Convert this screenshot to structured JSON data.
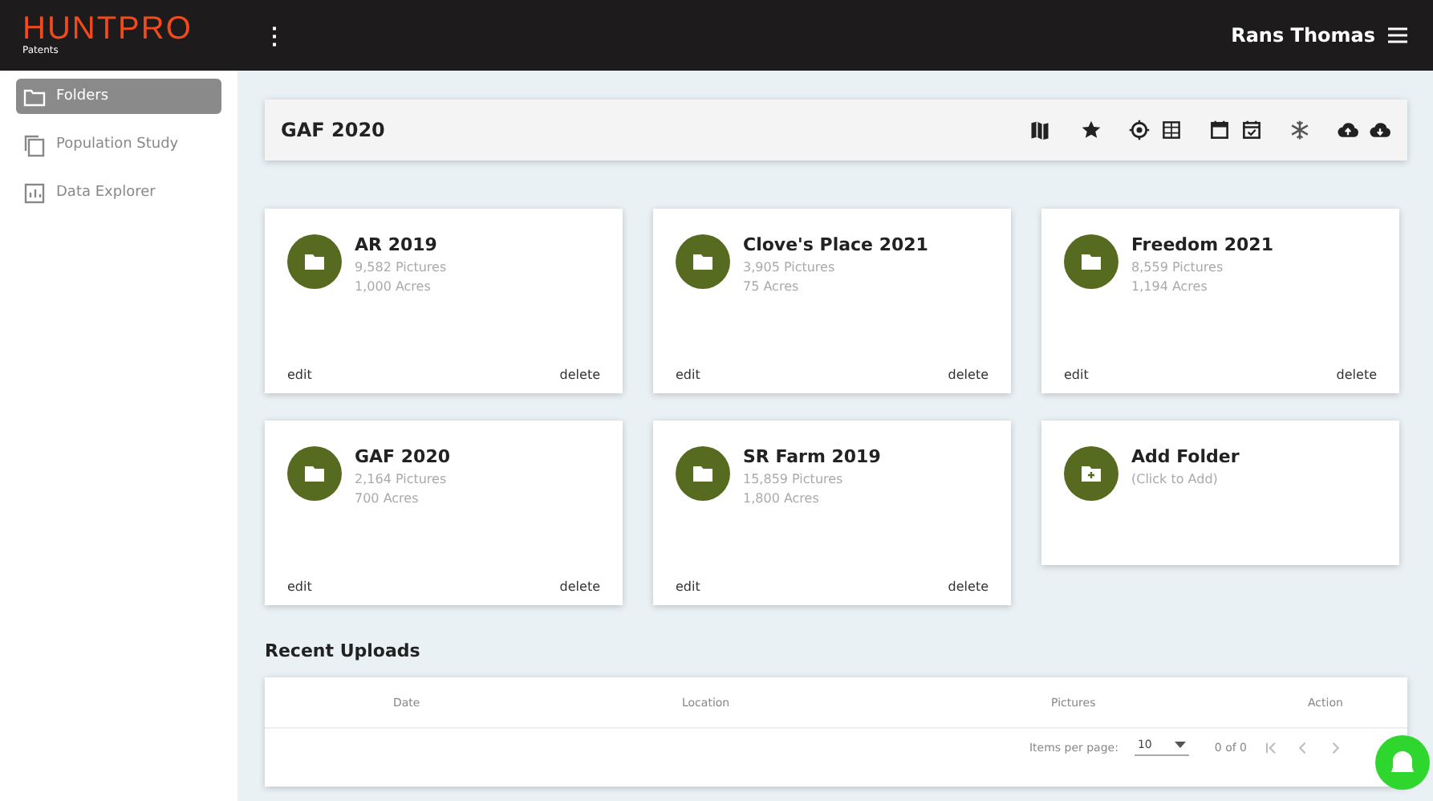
{
  "topbar": {
    "logo": "HUNTPRO",
    "logo_subtitle": "Patents",
    "menu_glyph": "⋮",
    "user": "Rans Thomas"
  },
  "sidebar": {
    "items": [
      {
        "label": "Folders",
        "selected": true
      },
      {
        "label": "Population Study",
        "selected": false
      },
      {
        "label": "Data Explorer",
        "selected": false
      }
    ]
  },
  "header": {
    "title": "GAF 2020"
  },
  "folders": [
    {
      "kind": "folder",
      "name": "AR 2019",
      "pictures": "9,582 Pictures",
      "acres": "1,000 Acres",
      "edit": "edit",
      "delete": "delete"
    },
    {
      "kind": "folder",
      "name": "Clove's Place 2021",
      "pictures": "3,905 Pictures",
      "acres": "75 Acres",
      "edit": "edit",
      "delete": "delete"
    },
    {
      "kind": "folder",
      "name": "Freedom 2021",
      "pictures": "8,559 Pictures",
      "acres": "1,194 Acres",
      "edit": "edit",
      "delete": "delete"
    },
    {
      "kind": "folder",
      "name": "GAF 2020",
      "pictures": "2,164 Pictures",
      "acres": "700 Acres",
      "edit": "edit",
      "delete": "delete"
    },
    {
      "kind": "folder",
      "name": "SR Farm 2019",
      "pictures": "15,859 Pictures",
      "acres": "1,800 Acres",
      "edit": "edit",
      "delete": "delete"
    },
    {
      "kind": "add",
      "name": "Add Folder",
      "hint": "(Click to Add)"
    }
  ],
  "recent_uploads": {
    "title": "Recent Uploads",
    "columns": [
      "Date",
      "Location",
      "Pictures",
      "Action"
    ],
    "paginator": {
      "label": "Items per page:",
      "page_size": "10",
      "range": "0 of 0"
    }
  }
}
